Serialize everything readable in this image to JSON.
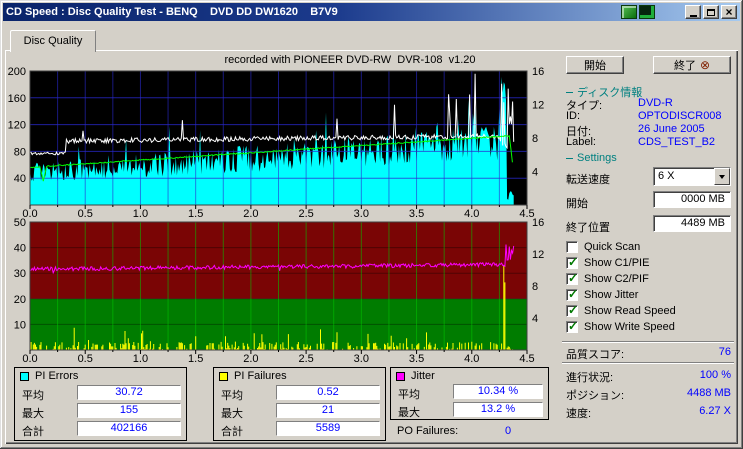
{
  "window": {
    "title": "CD Speed : Disc Quality Test - BENQ    DVD DD DW1620    B7V9",
    "tab": "Disc Quality"
  },
  "chart_data": [
    {
      "type": "area",
      "title": "recorded with PIONEER DVD-RW  DVR-108  v1.20",
      "x": {
        "lim": [
          0,
          4.5
        ],
        "ticks": [
          "0.0",
          "0.5",
          "1.0",
          "1.5",
          "2.0",
          "2.5",
          "3.0",
          "3.5",
          "4.0",
          "4.5"
        ],
        "unit": "GB",
        "data_end": 4.38
      },
      "left_axis": {
        "lim": [
          0,
          200
        ],
        "ticks": [
          200,
          160,
          120,
          80,
          40
        ]
      },
      "right_axis": {
        "lim": [
          0,
          16
        ],
        "ticks": [
          16,
          12,
          8,
          4
        ]
      },
      "background": "#000000",
      "grid_color": "#2a2ad2",
      "series": [
        {
          "name": "PI Errors",
          "style": "filled-noisy-area",
          "color": "#00ffff",
          "axis": "left",
          "avg": 30.72,
          "max": 155,
          "approx_start": 48,
          "approx_end": 95,
          "end_spike": 198
        },
        {
          "name": "Read Speed",
          "style": "noisy-line-with-spikes",
          "color": "#ffffff",
          "axis": "left",
          "approx_start": 77,
          "step_at": 0.33,
          "approx_level": 95,
          "spike_max": 196
        },
        {
          "name": "Write Speed",
          "style": "line",
          "color": "#00ff00",
          "axis": "right",
          "start_x": 4.5,
          "end_x": 8.3,
          "dip_at": 0.12
        }
      ]
    },
    {
      "type": "line",
      "x": {
        "lim": [
          0,
          4.5
        ],
        "ticks": [
          "0.0",
          "0.5",
          "1.0",
          "1.5",
          "2.0",
          "2.5",
          "3.0",
          "3.5",
          "4.0",
          "4.5"
        ],
        "unit": "GB",
        "data_end": 4.38
      },
      "left_axis": {
        "lim": [
          0,
          50
        ],
        "ticks": [
          50,
          40,
          30,
          20,
          10
        ]
      },
      "right_axis": {
        "lim": [
          0,
          16
        ],
        "ticks": [
          16,
          12,
          8,
          4
        ]
      },
      "background_zones": [
        {
          "from": 0,
          "to": 20,
          "color": "#007c00"
        },
        {
          "from": 20,
          "to": 50,
          "color": "#7a0505"
        }
      ],
      "grid_color": "#00c800",
      "hgrid_color": "rgba(0,0,0,0.35)",
      "series": [
        {
          "name": "Jitter",
          "style": "noisy-line",
          "color": "#ff00ff",
          "axis": "right",
          "avg": 10.34,
          "max": 13.2,
          "approx_start": 10.1,
          "approx_end": 10.7
        },
        {
          "name": "PI Failures",
          "style": "spikes",
          "color": "#ffff00",
          "axis": "left",
          "avg": 0.52,
          "max": 21,
          "end_spike": 45
        }
      ]
    }
  ],
  "buttons": {
    "start": "開始",
    "exit": "終了"
  },
  "disc_info": {
    "header": "ディスク情報",
    "rows": [
      {
        "label": "タイプ:",
        "value": "DVD-R"
      },
      {
        "label": "ID:",
        "value": "OPTODISCR008"
      },
      {
        "label": "日付:",
        "value": "26 June 2005"
      },
      {
        "label": "Label:",
        "value": "CDS_TEST_B2"
      }
    ]
  },
  "settings": {
    "header": "Settings",
    "speed_label": "転送速度",
    "speed_value": "6 X",
    "start_label": "開始",
    "start_value": "0000 MB",
    "end_label": "終了位置",
    "end_value": "4489 MB",
    "checkboxes": [
      {
        "label": "Quick Scan",
        "checked": false
      },
      {
        "label": "Show C1/PIE",
        "checked": true
      },
      {
        "label": "Show C2/PIF",
        "checked": true
      },
      {
        "label": "Show Jitter",
        "checked": true
      },
      {
        "label": "Show Read Speed",
        "checked": true
      },
      {
        "label": "Show Write Speed",
        "checked": true
      }
    ]
  },
  "score": {
    "label": "品質スコア:",
    "value": "76"
  },
  "status": [
    {
      "label": "進行状況:",
      "value": "100 %"
    },
    {
      "label": "ポジション:",
      "value": "4488 MB"
    },
    {
      "label": "速度:",
      "value": "6.27 X"
    }
  ],
  "stats_boxes": [
    {
      "title": "PI Errors",
      "color": "#00ffff",
      "rows": [
        {
          "label": "平均",
          "value": "30.72"
        },
        {
          "label": "最大",
          "value": "155"
        },
        {
          "label": "合計",
          "value": "402166"
        }
      ]
    },
    {
      "title": "PI Failures",
      "color": "#ffff00",
      "rows": [
        {
          "label": "平均",
          "value": "0.52"
        },
        {
          "label": "最大",
          "value": "21"
        },
        {
          "label": "合計",
          "value": "5589"
        }
      ]
    },
    {
      "title": "Jitter",
      "color": "#ff00ff",
      "rows": [
        {
          "label": "平均",
          "value": "10.34 %"
        },
        {
          "label": "最大",
          "value": "13.2 %"
        }
      ]
    }
  ],
  "po_failures": {
    "label": "PO Failures:",
    "value": "0"
  }
}
